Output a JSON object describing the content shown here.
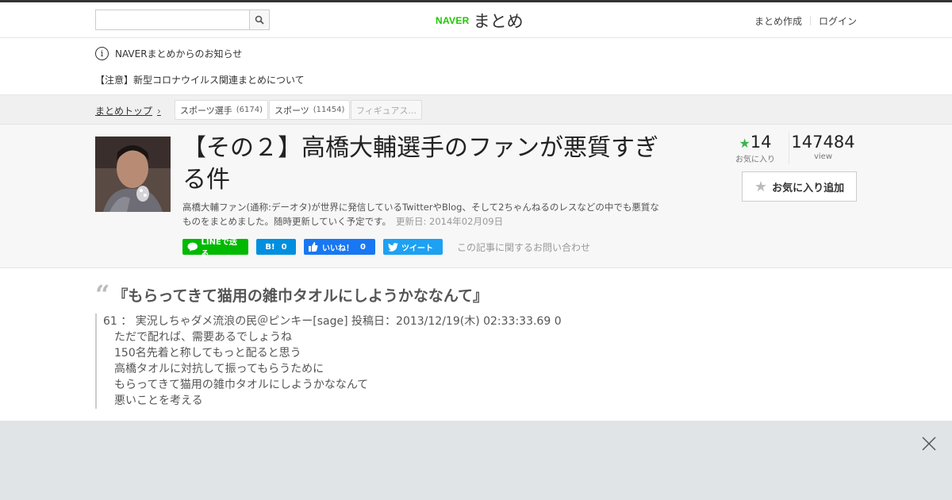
{
  "header": {
    "logo_naver": "NAVER",
    "logo_matome": "まとめ",
    "search_placeholder": "",
    "search_icon": "search-icon",
    "links": [
      "まとめ作成",
      "ログイン"
    ]
  },
  "notice": {
    "title": "NAVERまとめからのお知らせ",
    "item": "【注意】新型コロナウイルス関連まとめについて"
  },
  "breadcrumb": {
    "top": "まとめトップ",
    "tags": [
      {
        "label": "スポーツ選手",
        "count": "(6174)"
      },
      {
        "label": "スポーツ",
        "count": "(11454)"
      },
      {
        "label": "フィギュアス...",
        "count": ""
      }
    ]
  },
  "article": {
    "title": "【その２】高橋大輔選手のファンが悪質すぎる件",
    "description": "高橋大輔ファン(通称:デーオタ)が世界に発信しているTwitterやBlog、そして2ちゃんねるのレスなどの中でも悪質なものをまとめました。随時更新していく予定です。",
    "updated": "更新日: 2014年02月09日",
    "favorites": "14",
    "favorites_label": "お気に入り",
    "views": "147484",
    "views_label": "view",
    "fav_button": "お気に入り追加",
    "contact": "この記事に関するお問い合わせ"
  },
  "social": {
    "line": "LINEで送る",
    "hatena_logo": "B!",
    "hatena_count": "0",
    "fb_label": "いいね！",
    "fb_count": "0",
    "tweet": "ツイート"
  },
  "quote": {
    "heading": "『もらってきて猫用の雑巾タオルにしようかななんて』",
    "meta": "61 ： 実況しちゃダメ流浪の民＠ピンキー[sage] 投稿日：2013/12/19(木) 02:33:33.69 0",
    "lines": [
      "ただで配れば、需要あるでしょうね",
      "150名先着と称してもっと配ると思う",
      "高橋タオルに対抗して振ってもらうために",
      "もらってきて猫用の雑巾タオルにしようかななんて",
      "悪いことを考える"
    ]
  },
  "colors": {
    "naver_green": "#1ec800",
    "fav_star": "#3cb44b",
    "line": "#00b900",
    "hatena": "#008fde",
    "facebook": "#1877f2",
    "twitter": "#1da1f2"
  }
}
